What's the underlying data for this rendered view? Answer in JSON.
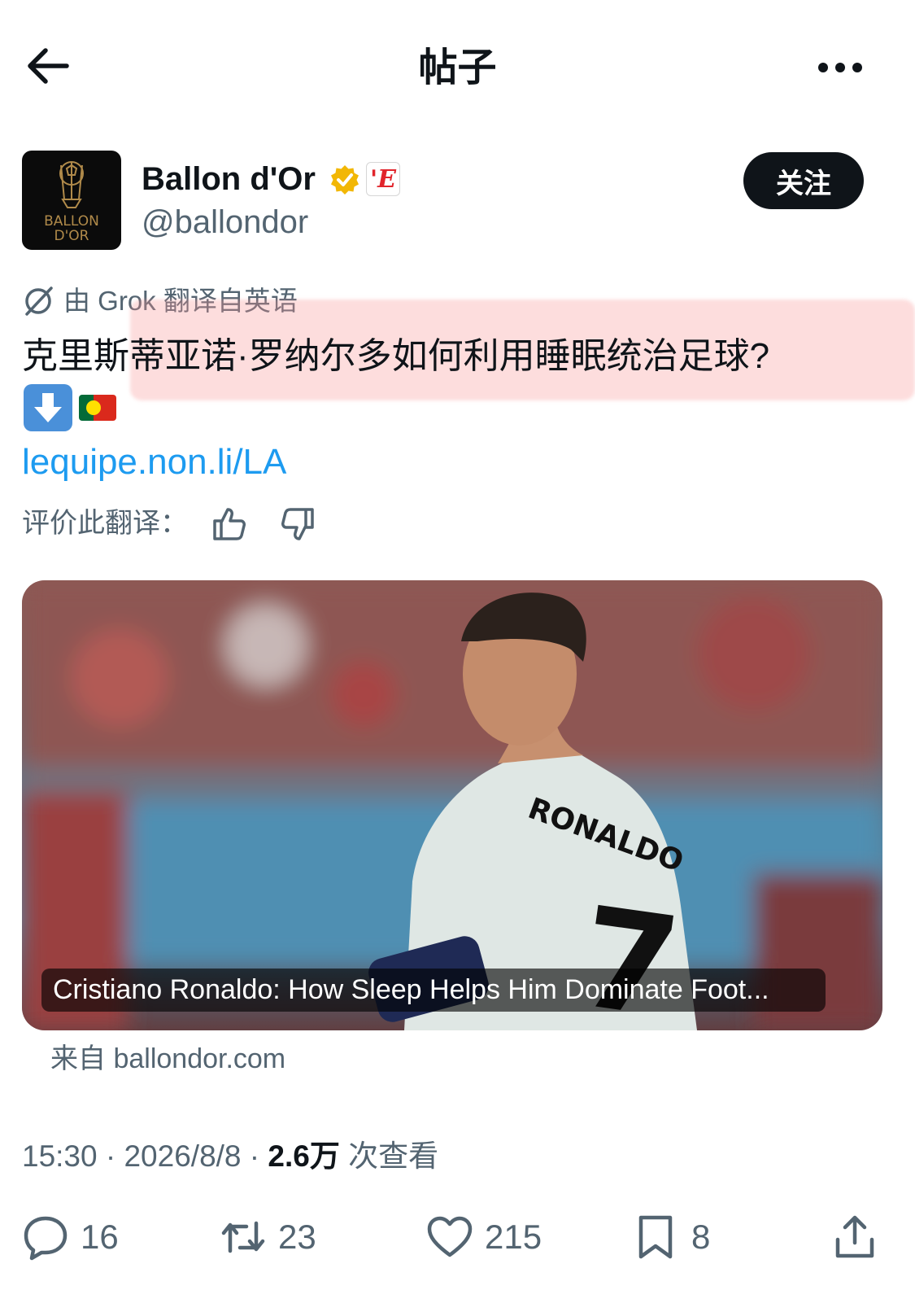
{
  "header": {
    "title": "帖子"
  },
  "author": {
    "display_name": "Ballon d'Or",
    "handle": "@ballondor",
    "avatar_text": "BALLON D'OR",
    "affiliation_badge": "'E",
    "follow_label": "关注"
  },
  "translation": {
    "note": "由 Grok 翻译自英语",
    "rate_label": "评价此翻译："
  },
  "post": {
    "text": "克里斯蒂亚诺·罗纳尔多如何利用睡眠统治足球?",
    "link": "lequipe.non.li/LA"
  },
  "card": {
    "caption": "Cristiano Ronaldo: How Sleep Helps Him Dominate Foot...",
    "source": "来自 ballondor.com",
    "jersey_name": "RONALDO",
    "jersey_number": "7"
  },
  "meta": {
    "time": "15:30",
    "date": "2026/8/8",
    "views": "2.6万",
    "views_label": "次查看"
  },
  "actions": {
    "replies": "16",
    "reposts": "23",
    "likes": "215",
    "bookmarks": "8"
  },
  "colors": {
    "link": "#1d9bf0",
    "verified": "#f2b705",
    "accent_text": "#0f1419",
    "secondary_text": "#536471"
  },
  "icons": [
    "back-arrow-icon",
    "more-icon",
    "verified-badge-icon",
    "grok-icon",
    "thumb-up-icon",
    "thumb-down-icon",
    "down-arrow-emoji",
    "portugal-flag-emoji",
    "reply-icon",
    "repost-icon",
    "like-icon",
    "bookmark-icon",
    "share-icon"
  ]
}
